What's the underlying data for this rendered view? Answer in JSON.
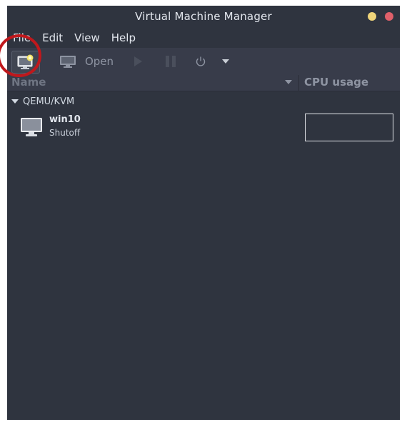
{
  "window": {
    "title": "Virtual Machine Manager"
  },
  "menubar": {
    "items": [
      "File",
      "Edit",
      "View",
      "Help"
    ]
  },
  "toolbar": {
    "open_label": "Open"
  },
  "vm_list": {
    "columns": {
      "name": "Name",
      "cpu": "CPU usage"
    },
    "groups": [
      {
        "label": "QEMU/KVM",
        "vms": [
          {
            "name": "win10",
            "status": "Shutoff"
          }
        ]
      }
    ]
  },
  "colors": {
    "window_bg": "#2f343f",
    "toolbar_bg": "#383c4a",
    "highlight_ring": "#c0181c",
    "minimize_button": "#f0d57a",
    "close_button": "#e0606a"
  }
}
